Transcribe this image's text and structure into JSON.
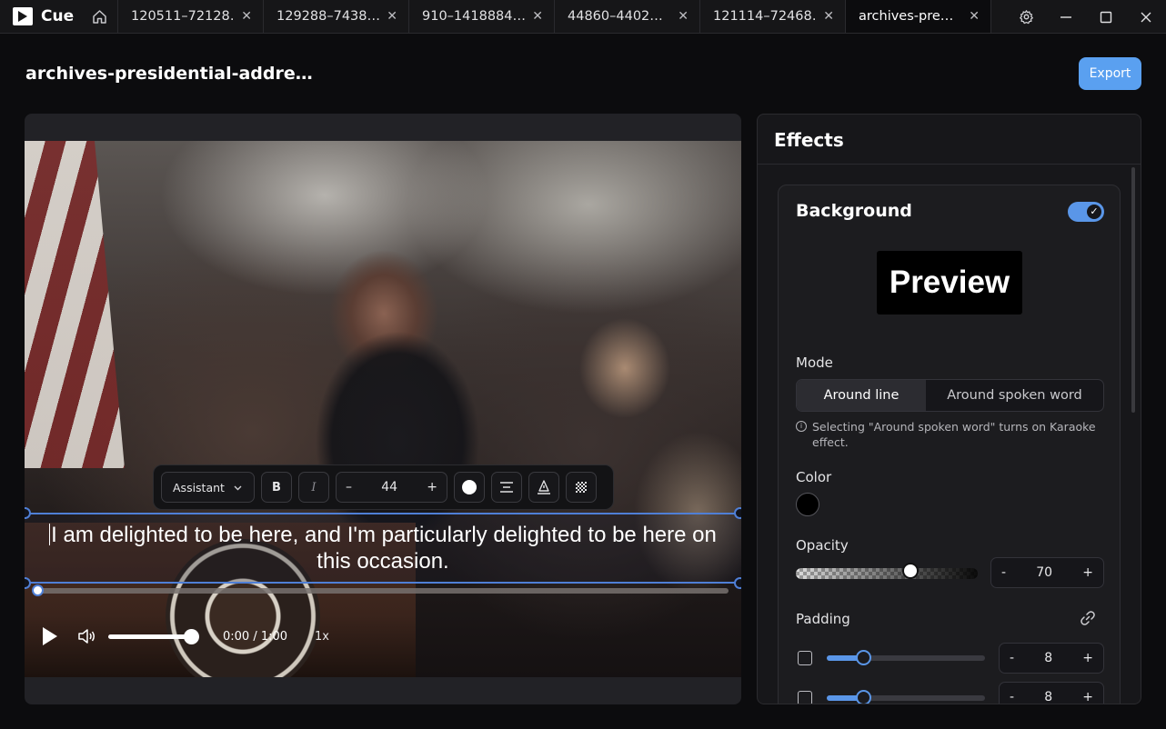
{
  "app": {
    "name": "Cue"
  },
  "tabs": [
    {
      "label": "120511–72128…"
    },
    {
      "label": "129288–7438…"
    },
    {
      "label": "910–1418884…"
    },
    {
      "label": "44860–4402…"
    },
    {
      "label": "121114–72468…"
    },
    {
      "label": "archives-pre…"
    }
  ],
  "header": {
    "title": "archives-presidential-addre…",
    "export_label": "Export"
  },
  "player": {
    "subtitle": "I am delighted to be here, and I'm particularly delighted to be here on this occasion.",
    "toolbar": {
      "font": "Assistant",
      "bold": "B",
      "italic": "I",
      "minus": "–",
      "size": "44",
      "plus": "+"
    },
    "time": "0:00 / 1:00",
    "speed": "1x",
    "progress_fraction": 0,
    "volume_fraction": 1
  },
  "effects": {
    "title": "Effects",
    "background": {
      "title": "Background",
      "enabled": true,
      "preview_text": "Preview",
      "mode_label": "Mode",
      "mode_options": [
        "Around line",
        "Around spoken word"
      ],
      "mode_selected": "Around line",
      "hint": "Selecting \"Around spoken word\" turns on Karaoke effect.",
      "color_label": "Color",
      "color_value": "#000000",
      "opacity_label": "Opacity",
      "opacity_value": "70",
      "padding_label": "Padding",
      "padding_horizontal": "8",
      "padding_vertical": "8",
      "stepper_minus": "-",
      "stepper_plus": "+"
    }
  },
  "colors": {
    "accent": "#5aa0f0",
    "selection": "#4f7fd6"
  }
}
